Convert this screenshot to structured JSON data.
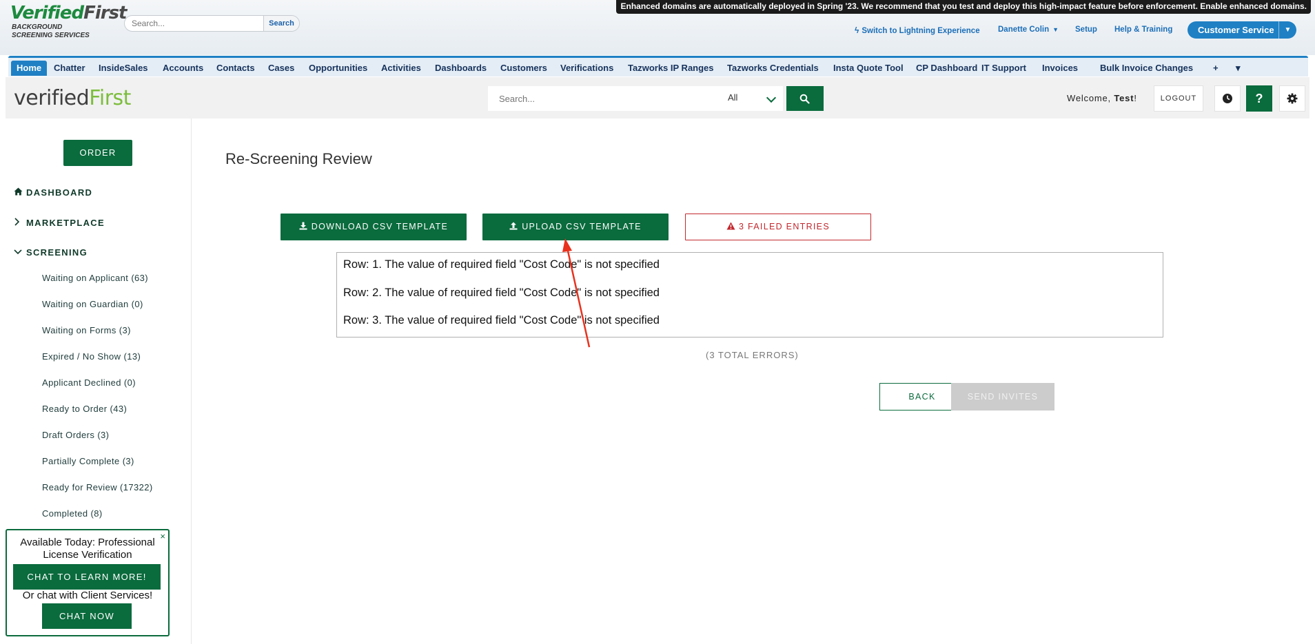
{
  "salesforce": {
    "logo_main": "VerifiedFirst",
    "logo_main_a": "Verified",
    "logo_main_b": "First",
    "logo_sub_1": "BACKGROUND",
    "logo_sub_2": "SCREENING SERVICES",
    "search_placeholder": "Search...",
    "search_button": "Search",
    "banner": "Enhanced domains are automatically deployed in Spring '23. We recommend that you test and deploy this high-impact feature before enforcement. Enable enhanced domains.",
    "links": {
      "lightning": "Switch to Lightning Experience",
      "user": "Danette Colin",
      "setup": "Setup",
      "help": "Help & Training"
    },
    "app_menu": "Customer Service",
    "tabs": [
      "Home",
      "Chatter",
      "InsideSales",
      "Accounts",
      "Contacts",
      "Cases",
      "Opportunities",
      "Activities",
      "Dashboards",
      "Customers",
      "Verifications",
      "Tazworks IP Ranges",
      "Tazworks Credentials",
      "Insta Quote Tool",
      "CP Dashboard",
      "IT Support",
      "Invoices",
      "Bulk Invoice Changes",
      "+",
      "▾"
    ],
    "active_tab": "Home"
  },
  "portal": {
    "logo_a": "verified",
    "logo_b": "First",
    "search_placeholder": "Search...",
    "search_scope": "All",
    "welcome_prefix": "Welcome, ",
    "welcome_name": "Test",
    "welcome_suffix": "!",
    "logout": "LOGOUT",
    "help_glyph": "?"
  },
  "sidebar": {
    "order_button": "ORDER",
    "main_items": [
      {
        "label": "DASHBOARD",
        "icon": "home-icon"
      },
      {
        "label": "MARKETPLACE",
        "icon": "chevron-right-icon"
      },
      {
        "label": "SCREENING",
        "icon": "chevron-down-icon"
      }
    ],
    "sub_items": [
      "Waiting on Applicant (63)",
      "Waiting on Guardian (0)",
      "Waiting on Forms (3)",
      "Expired / No Show (13)",
      "Applicant Declined (0)",
      "Ready to Order (43)",
      "Draft Orders (3)",
      "Partially Complete (3)",
      "Ready for Review (17322)",
      "Completed (8)"
    ]
  },
  "main": {
    "title": "Re-Screening Review",
    "download_button": "DOWNLOAD CSV TEMPLATE",
    "upload_button": "UPLOAD CSV TEMPLATE",
    "failed_button": "3 FAILED ENTRIES",
    "errors": [
      "Row: 1. The value of required field \"Cost Code\" is not specified",
      "Row: 2. The value of required field \"Cost Code\" is not specified",
      "Row: 3. The value of required field \"Cost Code\" is not specified"
    ],
    "total_errors": "(3 TOTAL ERRORS)",
    "back_button": "BACK",
    "send_button": "SEND INVITES"
  },
  "promo": {
    "title": "Available Today: Professional License Verification",
    "chat_button": "CHAT TO LEARN MORE!",
    "or_text": "Or chat with Client Services!",
    "chat_now": "CHAT NOW",
    "close": "×"
  },
  "colors": {
    "brand_green": "#0a6b3d",
    "salesforce_blue": "#1f80c4",
    "error_red": "#c2272d",
    "annotation_arrow": "#e8321e"
  }
}
